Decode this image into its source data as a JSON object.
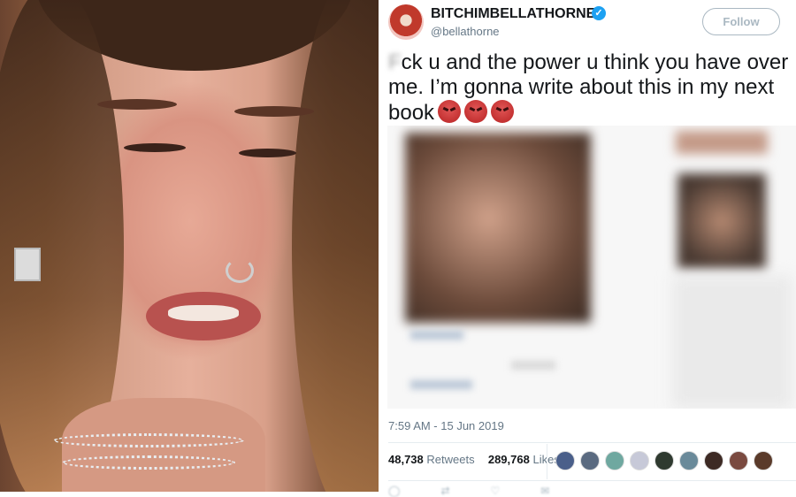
{
  "tweet": {
    "display_name": "BITCHIMBELLATHORNE",
    "verified_glyph": "✓",
    "handle": "@bellathorne",
    "follow_label": "Follow",
    "text_censored": "F",
    "text_after_censor_char": "ck u and the power u think you have over me. I’m gonna write about this in my next book",
    "emoji": [
      "angry-face",
      "angry-face",
      "angry-face"
    ],
    "timestamp": "7:59 AM - 15 Jun 2019",
    "retweets_count": "48,738",
    "retweets_label": "Retweets",
    "likes_count": "289,768",
    "likes_label": "Likes"
  },
  "colors": {
    "twitter_blue": "#1da1f2",
    "text_primary": "#14171a",
    "text_secondary": "#657786",
    "emoji_red": "#d33a3a"
  },
  "likers": [
    {
      "name": "liker-1",
      "color": "#4a5f8a"
    },
    {
      "name": "liker-2",
      "color": "#5a6a80"
    },
    {
      "name": "liker-3",
      "color": "#6fa8a0"
    },
    {
      "name": "liker-4",
      "color": "#c7c9d8"
    },
    {
      "name": "liker-5",
      "color": "#2f3a30"
    },
    {
      "name": "liker-6",
      "color": "#6a8a9a"
    },
    {
      "name": "liker-7",
      "color": "#3d2a24"
    },
    {
      "name": "liker-8",
      "color": "#7a4a40"
    },
    {
      "name": "liker-9",
      "color": "#5a3a2a"
    }
  ]
}
